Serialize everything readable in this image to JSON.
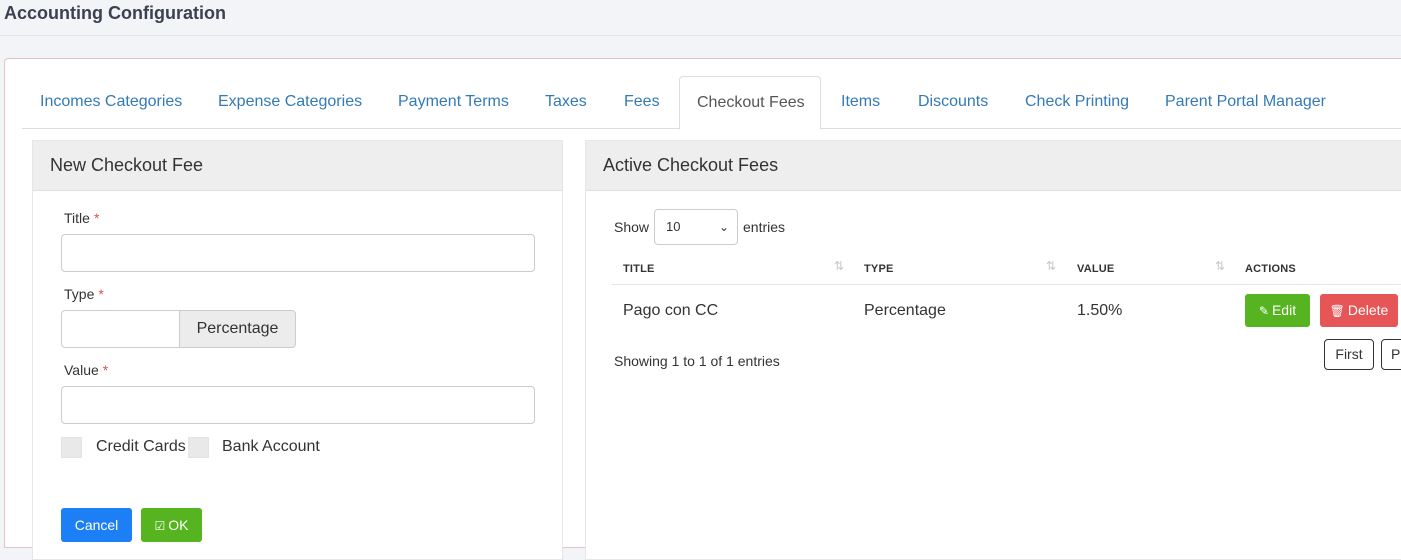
{
  "page": {
    "title": "Accounting Configuration"
  },
  "tabs": [
    {
      "label": "Incomes Categories"
    },
    {
      "label": "Expense Categories"
    },
    {
      "label": "Payment Terms"
    },
    {
      "label": "Taxes"
    },
    {
      "label": "Fees"
    },
    {
      "label": "Checkout Fees",
      "active": true
    },
    {
      "label": "Items"
    },
    {
      "label": "Discounts"
    },
    {
      "label": "Check Printing"
    },
    {
      "label": "Parent Portal Manager"
    }
  ],
  "form": {
    "title": "New Checkout Fee",
    "fields": {
      "title_label": "Title",
      "type_label": "Type",
      "value_label": "Value",
      "required_mark": "*",
      "title_value": "",
      "value_value": ""
    },
    "type_selected": "Percentage",
    "checkboxes": {
      "credit_cards": "Credit Cards",
      "bank_account": "Bank Account"
    },
    "cancel_label": "Cancel",
    "ok_label": "OK"
  },
  "list": {
    "title": "Active Checkout Fees",
    "show_label": "Show",
    "entries_label": "entries",
    "page_size": "10",
    "columns": [
      "TITLE",
      "TYPE",
      "VALUE",
      "ACTIONS"
    ],
    "rows": [
      {
        "title": "Pago con CC",
        "type": "Percentage",
        "value": "1.50%"
      }
    ],
    "edit_label": "Edit",
    "delete_label": "Delete",
    "info": "Showing 1 to 1 of 1 entries",
    "pager": {
      "first": "First",
      "previous": "P"
    }
  },
  "colors": {
    "primary": "#1c7ff5",
    "success": "#55b420",
    "danger": "#e65656",
    "link": "#337ab7"
  }
}
